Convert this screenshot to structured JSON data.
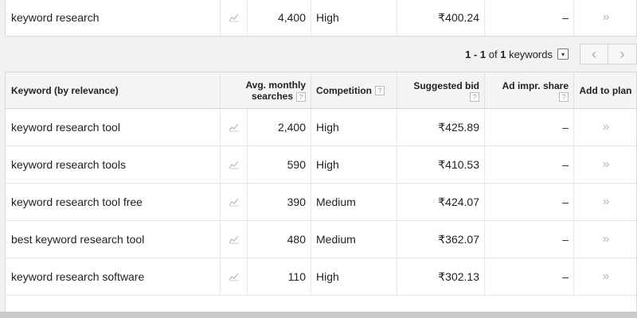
{
  "top_row": {
    "keyword": "keyword research",
    "searches": "4,400",
    "competition": "High",
    "bid": "₹400.24",
    "share": "–",
    "add": "»"
  },
  "pager": {
    "range": "1 - 1",
    "of_text": "of",
    "count": "1",
    "unit": "keywords",
    "dropdown": "▾",
    "prev": "‹",
    "next": "›"
  },
  "headers": {
    "keyword": "Keyword (by relevance)",
    "searches_line1": "Avg. monthly",
    "searches_line2": "searches",
    "competition": "Competition",
    "bid": "Suggested bid",
    "share": "Ad impr. share",
    "add": "Add to plan",
    "help": "?"
  },
  "rows": [
    {
      "keyword": "keyword research tool",
      "searches": "2,400",
      "competition": "High",
      "bid": "₹425.89",
      "share": "–",
      "add": "»"
    },
    {
      "keyword": "keyword research tools",
      "searches": "590",
      "competition": "High",
      "bid": "₹410.53",
      "share": "–",
      "add": "»"
    },
    {
      "keyword": "keyword research tool free",
      "searches": "390",
      "competition": "Medium",
      "bid": "₹424.07",
      "share": "–",
      "add": "»"
    },
    {
      "keyword": "best keyword research tool",
      "searches": "480",
      "competition": "Medium",
      "bid": "₹362.07",
      "share": "–",
      "add": "»"
    },
    {
      "keyword": "keyword research software",
      "searches": "110",
      "competition": "High",
      "bid": "₹302.13",
      "share": "–",
      "add": "»"
    }
  ],
  "icons": {
    "trend": "trend-chart-icon",
    "add": "double-chevron-right-icon"
  }
}
